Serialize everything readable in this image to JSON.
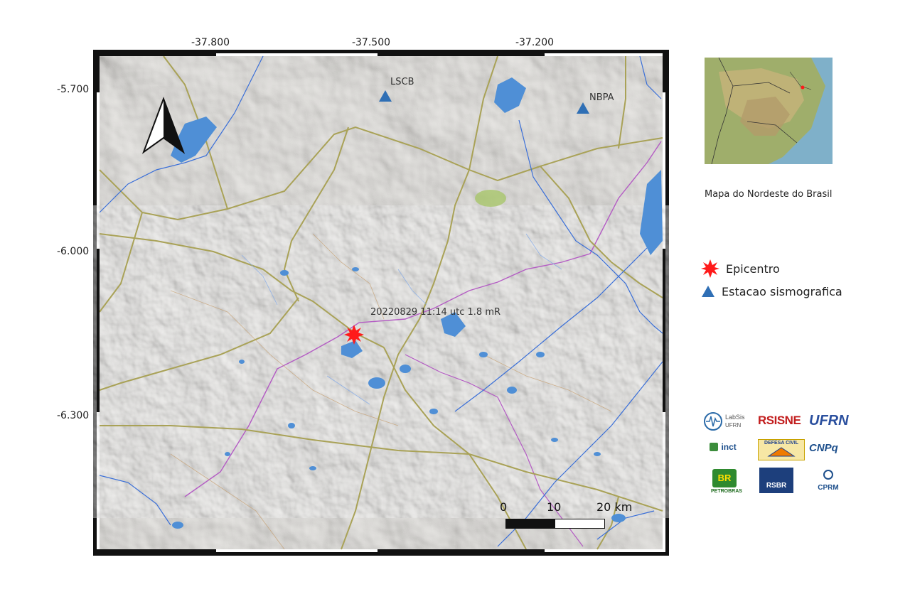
{
  "axes": {
    "lon_ticks": [
      "-37.800",
      "-37.500",
      "-37.200"
    ],
    "lat_ticks": [
      "-5.700",
      "-6.000",
      "-6.300"
    ]
  },
  "stations": [
    {
      "label": "LSCB"
    },
    {
      "label": "NBPA"
    }
  ],
  "event": {
    "label": "20220829 11:14 utc 1.8 mR"
  },
  "scale_bar": {
    "labels": [
      "0",
      "10",
      "20 km"
    ]
  },
  "inset": {
    "caption": "Mapa do Nordeste do Brasil"
  },
  "legend": {
    "epicenter": "Epicentro",
    "station": "Estacao sismografica"
  },
  "logos": {
    "labsis": "LabSis",
    "labsis_sub": "UFRN",
    "rsisne": "RSISNE",
    "ufrn": "UFRN",
    "inct": "inct",
    "defesa_civil": "DEFESA CIVIL",
    "cnpq": "CNPq",
    "br": "BR",
    "petrobras": "PETROBRAS",
    "rsbr": "RSBR",
    "cprm": "CPRM"
  },
  "colors": {
    "terrain": "#d9d6d0",
    "roads": "#a9a257",
    "rivers": "#3a6fd8",
    "reservoirs": "#4f8fd6",
    "boundary": "#b45cc4",
    "epicenter": "#ff1a1a",
    "station": "#2f6fb5"
  }
}
